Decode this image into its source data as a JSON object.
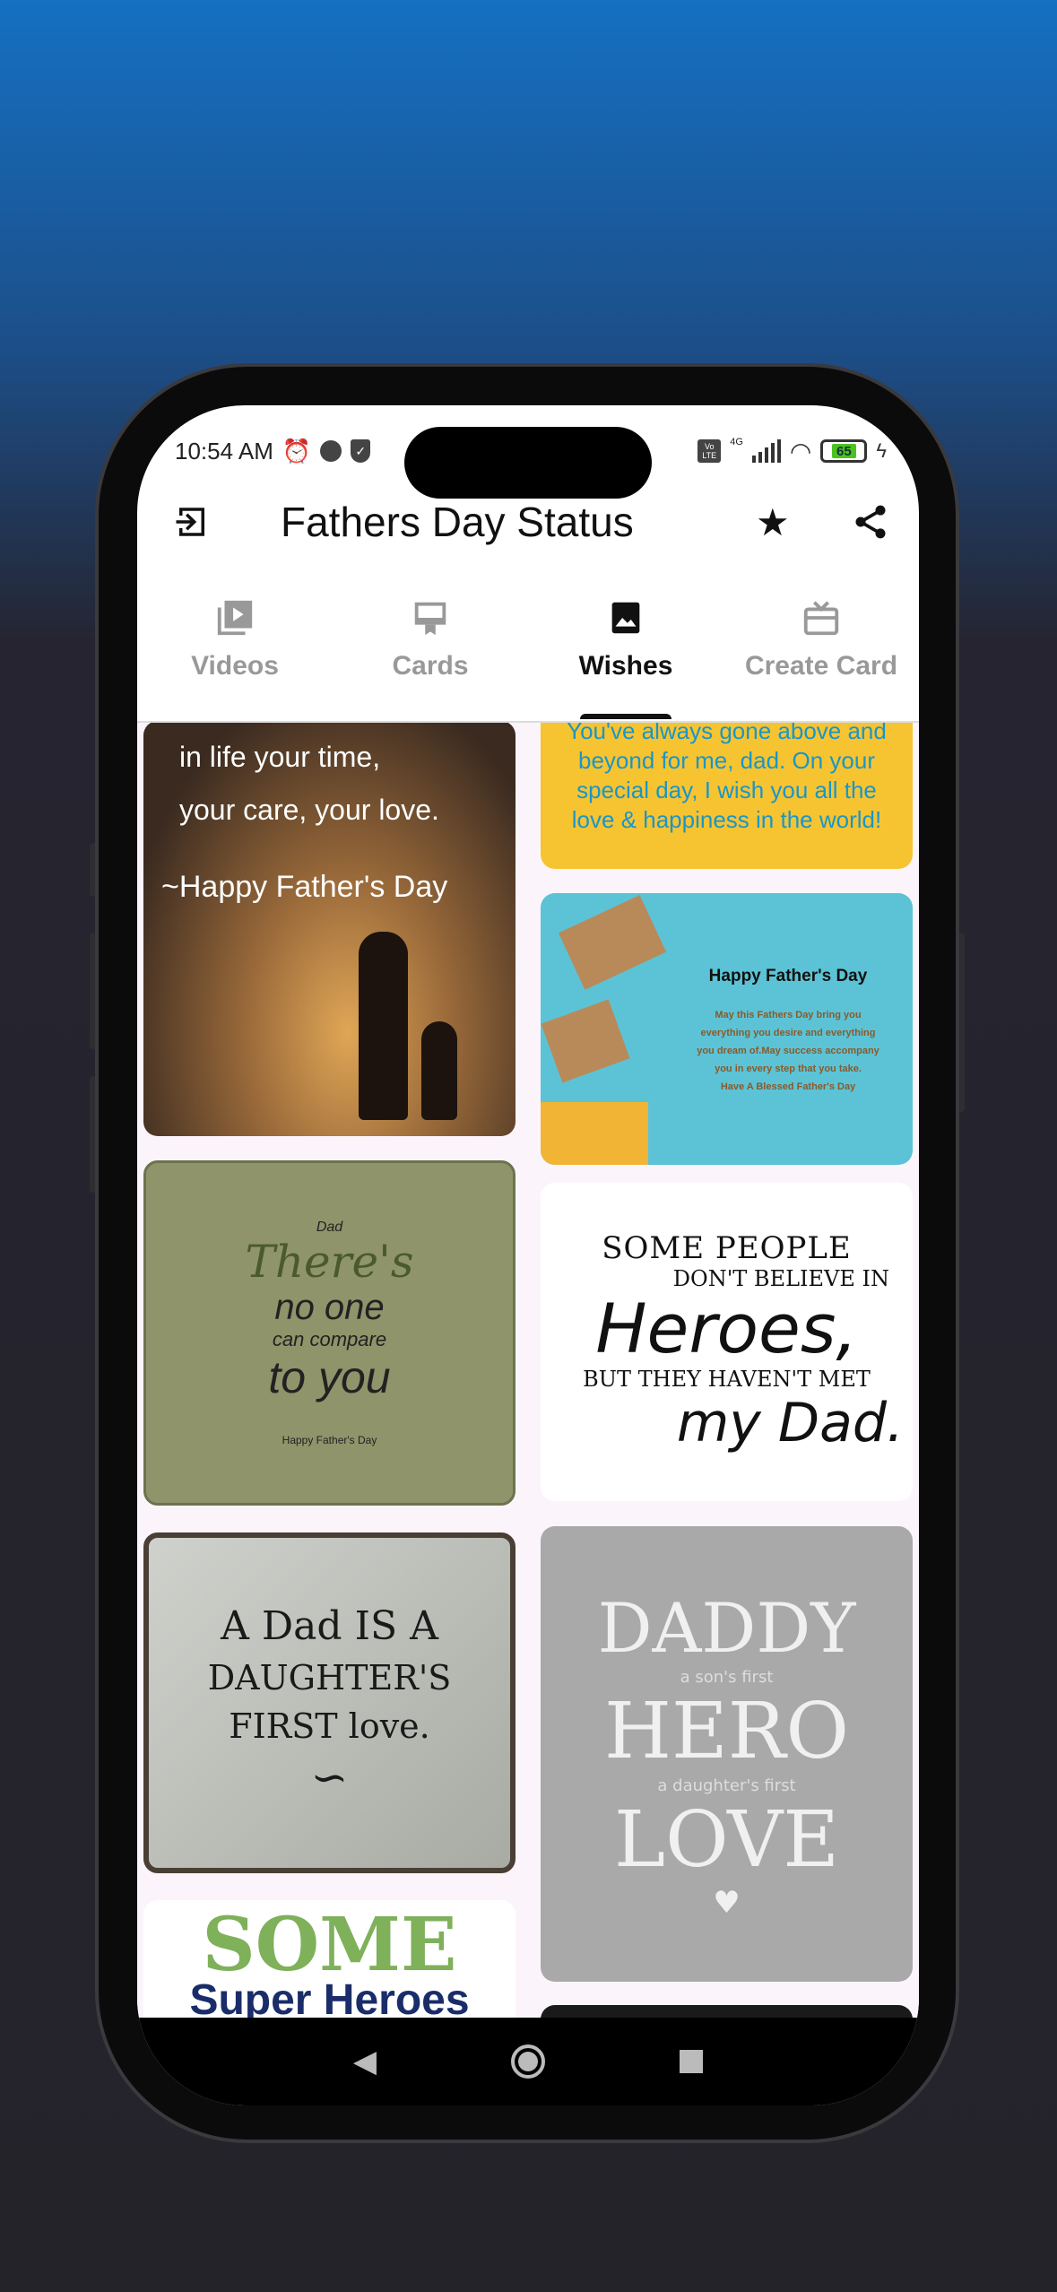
{
  "status_bar": {
    "time": "10:54 AM",
    "network": "4G",
    "volte": "Vo LTE",
    "battery": "65"
  },
  "toolbar": {
    "title": "Fathers Day Status",
    "icons": [
      "exit-icon",
      "star-icon",
      "share-icon"
    ]
  },
  "tabs": [
    {
      "label": "Videos",
      "icon": "video-library-icon"
    },
    {
      "label": "Cards",
      "icon": "card-icon"
    },
    {
      "label": "Wishes",
      "icon": "image-icon",
      "active": true
    },
    {
      "label": "Create Card",
      "icon": "gift-card-icon"
    }
  ],
  "wishes": {
    "left": [
      {
        "lines": [
          "in life your time,",
          "your care, your love.",
          "~Happy Father's Day"
        ]
      },
      {
        "lines": [
          "Dad",
          "There's",
          "no one",
          "can compare",
          "to you",
          "Happy Father's Day"
        ]
      },
      {
        "lines": [
          "A Dad IS A",
          "DAUGHTER'S",
          "FIRST love."
        ]
      },
      {
        "lines": [
          "SOME",
          "Super Heroes"
        ]
      }
    ],
    "right": [
      {
        "lines": [
          "You've always gone above and",
          "beyond for me, dad. On your",
          "special day, I wish you all the",
          "love & happiness in the world!"
        ]
      },
      {
        "lines": [
          "Happy Father's Day",
          "May this Fathers Day bring you",
          "everything you desire and everything",
          "you dream of.May success accompany",
          "you in every step that you take.",
          "Have A Blessed Father's Day"
        ]
      },
      {
        "lines": [
          "SOME PEOPLE",
          "DON'T BELIEVE IN",
          "Heroes,",
          "BUT THEY HAVEN'T MET",
          "my Dad."
        ]
      },
      {
        "lines": [
          "DADDY",
          "a son's first",
          "HERO",
          "a daughter's first",
          "LOVE"
        ]
      }
    ]
  },
  "colors": {
    "accent": "#111111",
    "inactive_tab": "#999999",
    "battery": "#4cc21e"
  }
}
